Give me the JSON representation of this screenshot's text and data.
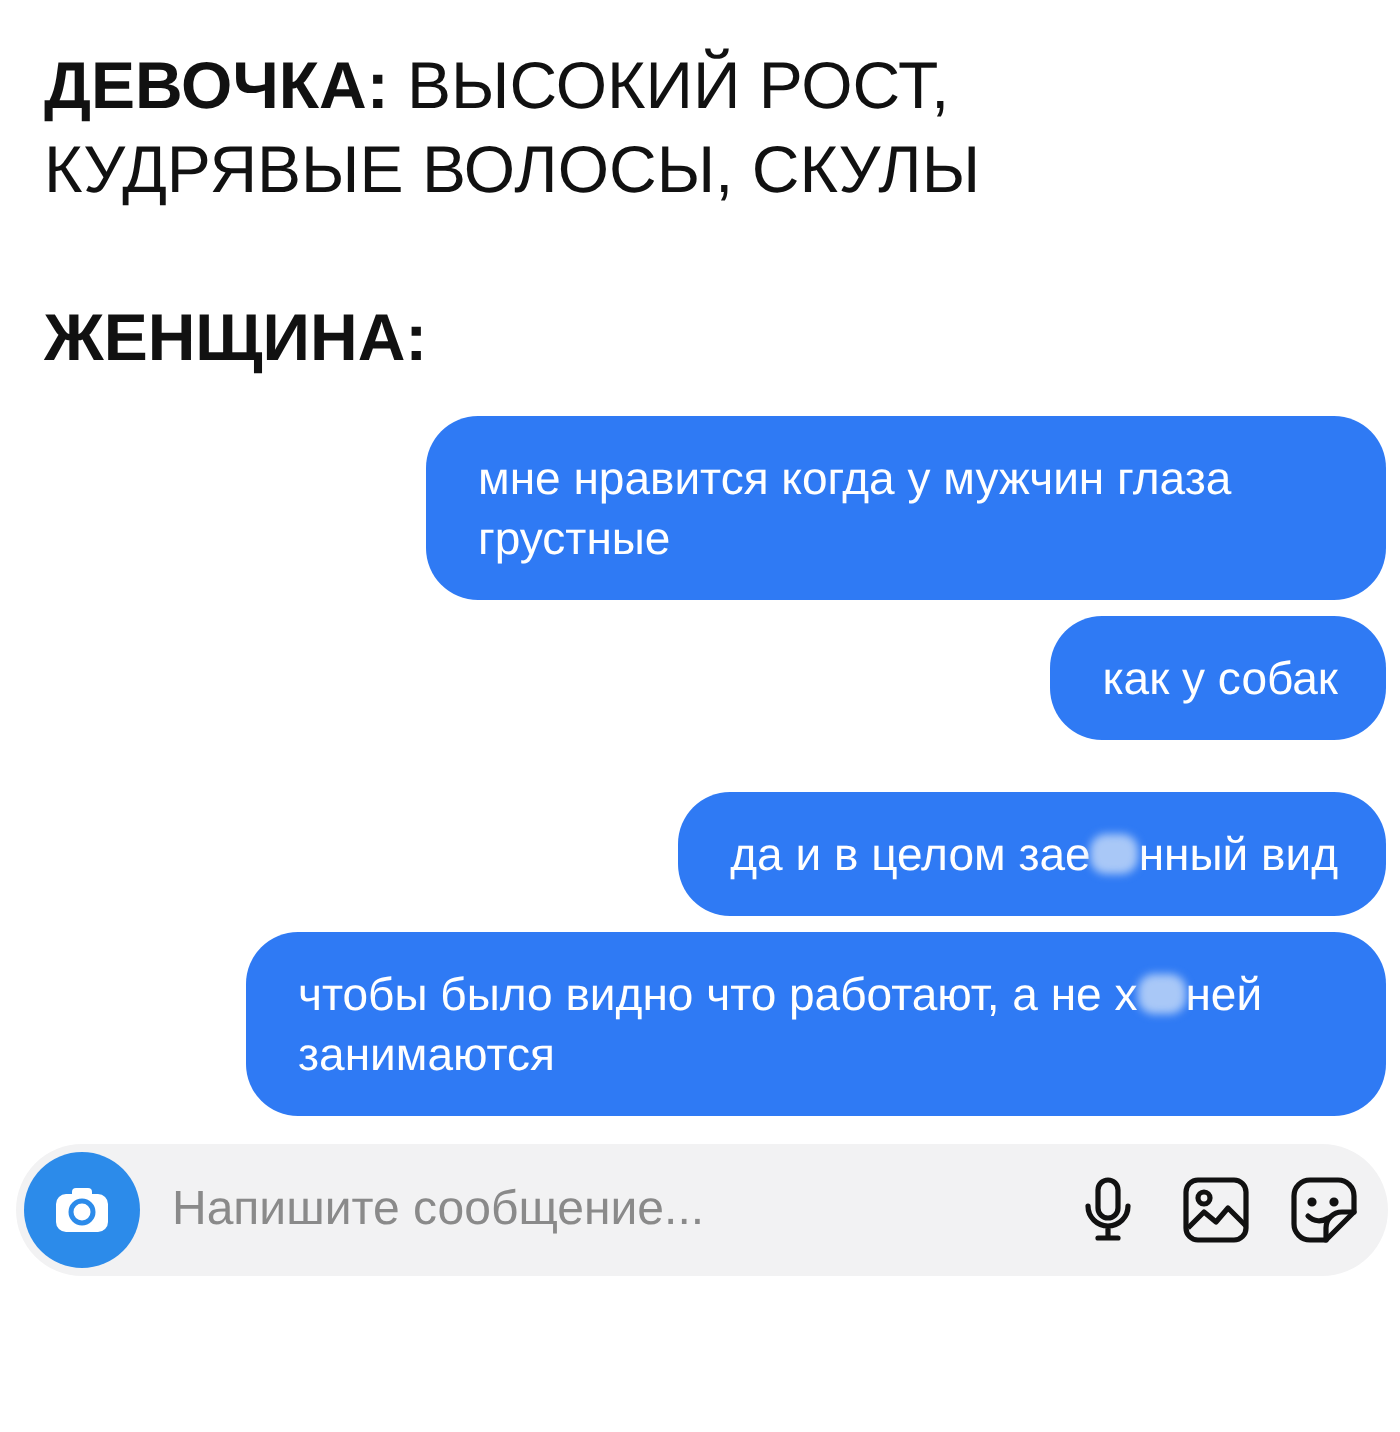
{
  "caption": [
    {
      "text": "**ДЕВОЧКА:** ВЫСОКИЙ РОСТ, КУДРЯВЫЕ ВОЛОСЫ, СКУЛЫ"
    },
    {
      "text": "ЖЕНЩИНА:"
    }
  ],
  "messages": [
    {
      "parts": [
        {
          "kind": "text",
          "text": "мне нравится когда у мужчин глаза грустные"
        }
      ]
    },
    {
      "parts": [
        {
          "kind": "text",
          "text": "как у собак"
        }
      ]
    },
    {
      "parts": [
        {
          "kind": "text",
          "text": "да и в целом зае"
        },
        {
          "kind": "censor"
        },
        {
          "kind": "text",
          "text": "нный вид"
        }
      ]
    },
    {
      "parts": [
        {
          "kind": "text",
          "text": "чтобы было видно что работают, а не х"
        },
        {
          "kind": "censor"
        },
        {
          "kind": "text",
          "text": "ней занимаются"
        }
      ]
    }
  ],
  "composer": {
    "placeholder": "Напишите сообщение..."
  }
}
